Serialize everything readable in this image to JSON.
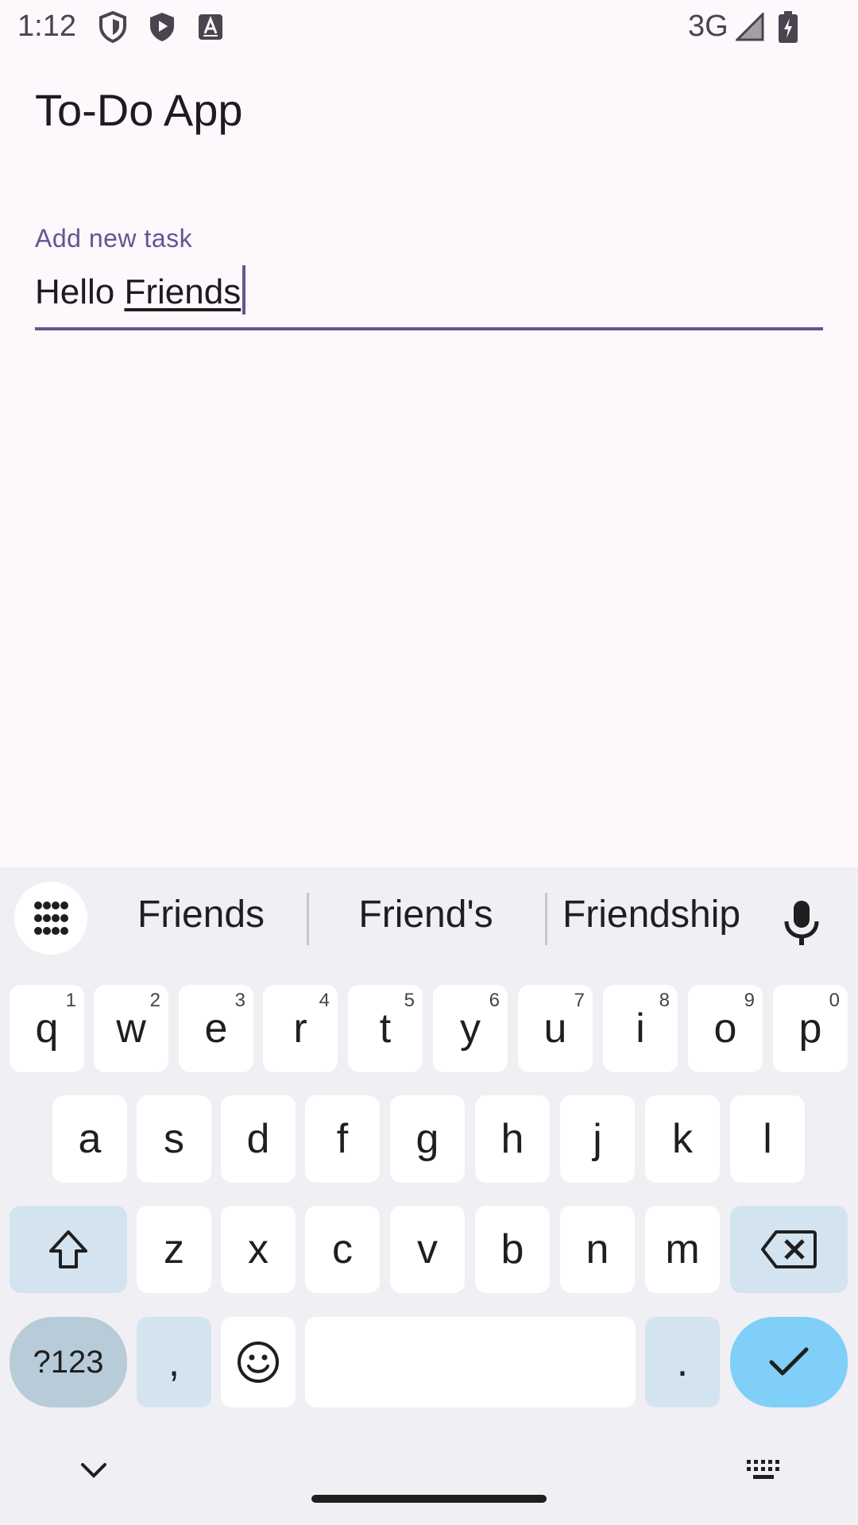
{
  "status_bar": {
    "time": "1:12",
    "network": "3G",
    "icons": [
      "shield-outline-icon",
      "shield-filled-icon",
      "font-a-icon",
      "signal-icon",
      "battery-charging-icon"
    ]
  },
  "app": {
    "title": "To-Do App"
  },
  "task_field": {
    "label": "Add new task",
    "value_committed": "Hello ",
    "value_composing": "Friends",
    "accent_color": "#65558f"
  },
  "keyboard": {
    "suggestions": [
      "Friends",
      "Friend's",
      "Friendship"
    ],
    "row1": [
      {
        "key": "q",
        "hint": "1"
      },
      {
        "key": "w",
        "hint": "2"
      },
      {
        "key": "e",
        "hint": "3"
      },
      {
        "key": "r",
        "hint": "4"
      },
      {
        "key": "t",
        "hint": "5"
      },
      {
        "key": "y",
        "hint": "6"
      },
      {
        "key": "u",
        "hint": "7"
      },
      {
        "key": "i",
        "hint": "8"
      },
      {
        "key": "o",
        "hint": "9"
      },
      {
        "key": "p",
        "hint": "0"
      }
    ],
    "row2": [
      "a",
      "s",
      "d",
      "f",
      "g",
      "h",
      "j",
      "k",
      "l"
    ],
    "row3": [
      "z",
      "x",
      "c",
      "v",
      "b",
      "n",
      "m"
    ],
    "symbols_label": "?123",
    "comma_label": ",",
    "period_label": ".",
    "colors": {
      "background": "#f0eff4",
      "key": "#ffffff",
      "special": "#d3e3f0",
      "enter": "#7fcff8",
      "symbols": "#b8cbd8"
    }
  }
}
